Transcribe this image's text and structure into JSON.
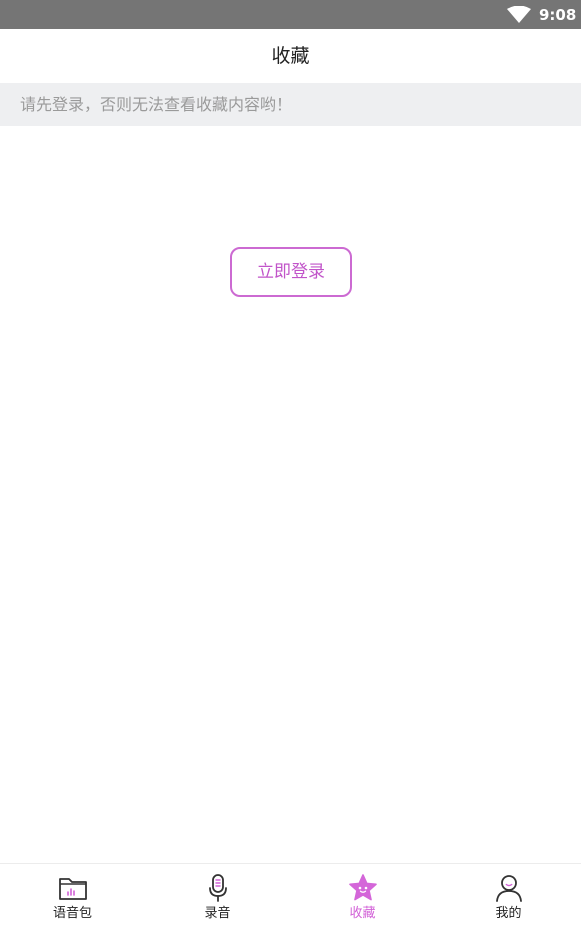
{
  "status_bar": {
    "time": "9:08",
    "wifi_icon": "wifi-icon"
  },
  "header": {
    "title": "收藏"
  },
  "notice": {
    "text": "请先登录，否则无法查看收藏内容哟！"
  },
  "main": {
    "login_button_label": "立即登录"
  },
  "tab_bar": {
    "tabs": [
      {
        "label": "语音包",
        "icon": "voice-pack-folder-icon",
        "active": false
      },
      {
        "label": "录音",
        "icon": "microphone-icon",
        "active": false
      },
      {
        "label": "收藏",
        "icon": "star-icon",
        "active": true
      },
      {
        "label": "我的",
        "icon": "person-icon",
        "active": false
      }
    ]
  },
  "colors": {
    "accent": "#cc6ad2",
    "status_bar": "#757575",
    "notice_background": "#eeeff1",
    "notice_text": "#9a9a9a"
  }
}
